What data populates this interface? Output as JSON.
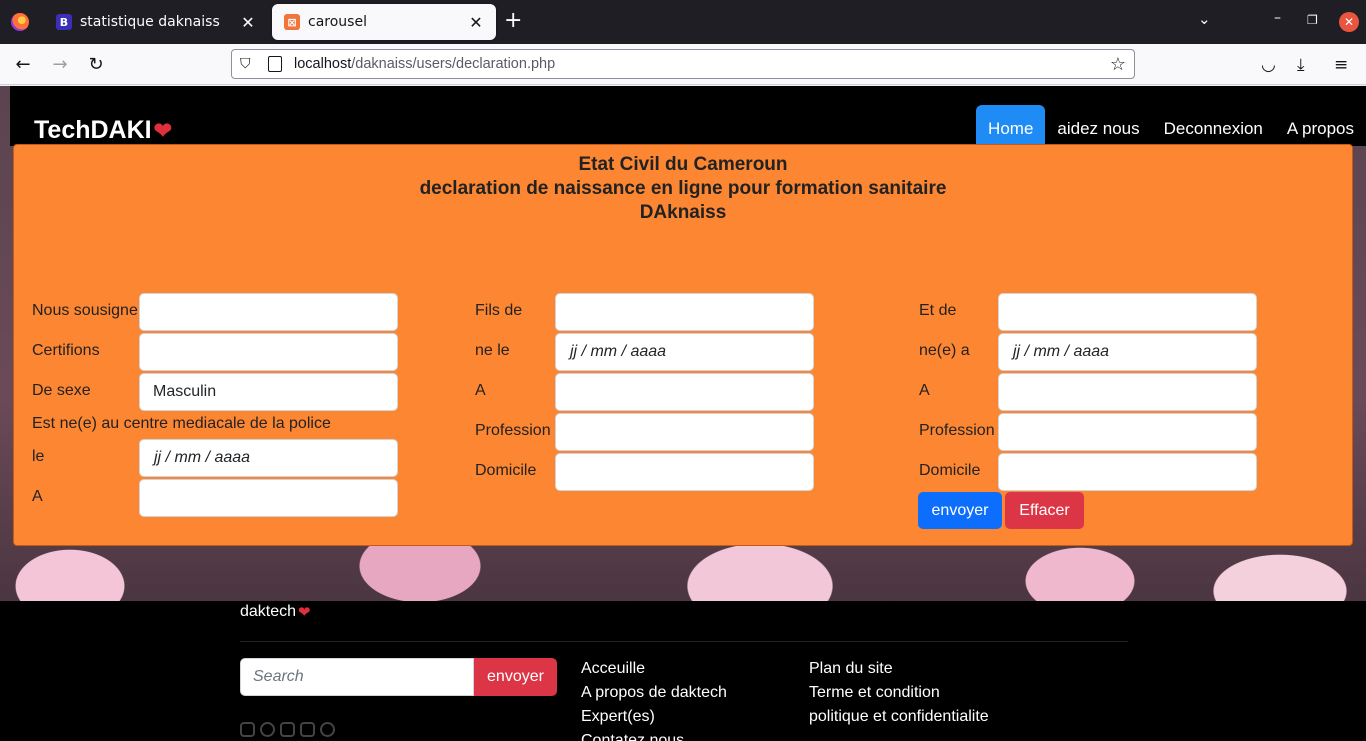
{
  "browser": {
    "tabs": [
      {
        "title": "statistique daknaiss",
        "favicon": "B"
      },
      {
        "title": "carousel",
        "favicon": "⊠"
      }
    ],
    "url_host": "localhost",
    "url_path": "/daknaiss/users/declaration.php"
  },
  "site": {
    "brand": "TechDAKI",
    "nav": [
      "Home",
      "aidez nous",
      "Deconnexion",
      "A propos"
    ]
  },
  "form": {
    "title_lines": [
      "Etat Civil du Cameroun",
      "declaration de naissance en ligne pour formation sanitaire",
      "DAknaiss"
    ],
    "col1": {
      "nous_sousigne": "Nous sousigne",
      "certifions": "Certifions",
      "de_sexe": "De sexe",
      "sexe_value": "Masculin",
      "est_ne": "Est ne(e) au centre mediacale de la police",
      "le": "le",
      "a": "A"
    },
    "col2": {
      "fils_de": "Fils de",
      "ne_le": "ne le",
      "a": "A",
      "profession": "Profession",
      "domicile": "Domicile"
    },
    "col3": {
      "et_de": "Et de",
      "ne_a": "ne(e) a",
      "a": "A",
      "profession": "Profession",
      "domicile": "Domicile"
    },
    "date_placeholder": "jj / mm / aaaa",
    "submit": "envoyer",
    "reset": "Effacer"
  },
  "footer": {
    "brand": "daktech",
    "search_placeholder": "Search",
    "search_button": "envoyer",
    "links_col1": [
      "Acceuille",
      "A propos de daktech",
      "Expert(es)",
      "Contatez nous"
    ],
    "links_col2": [
      "Plan du site",
      "Terme et condition",
      "politique et confidentialite"
    ]
  }
}
